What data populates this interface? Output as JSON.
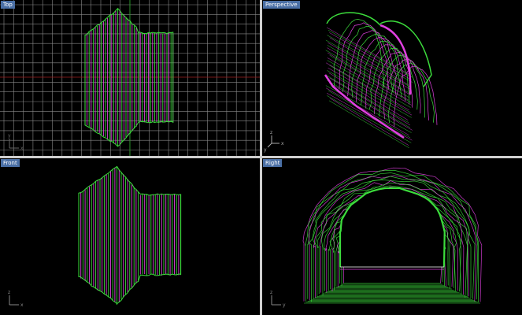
{
  "viewports": {
    "top": {
      "label": "Top"
    },
    "persp": {
      "label": "Perspective"
    },
    "front": {
      "label": "Front"
    },
    "right": {
      "label": "Right"
    }
  },
  "axis_labels": {
    "x": "x",
    "y": "y",
    "z": "z"
  },
  "colors": {
    "viewport_bg": "#000000",
    "grid": "#8a8a8a",
    "grid_axis_x": "#a02020",
    "grid_axis_y": "#20a020",
    "mesh_green": "#3cdc3c",
    "mesh_magenta": "#e040e0",
    "tab_bg": "#4a6fa5"
  }
}
